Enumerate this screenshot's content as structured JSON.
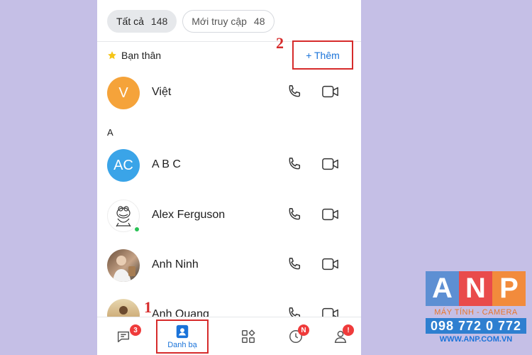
{
  "filters": {
    "all_label": "Tất cả",
    "all_count": "148",
    "recent_label": "Mới truy cập",
    "recent_count": "48"
  },
  "favorites": {
    "label": "Bạn thân",
    "add_label": "+ Thêm"
  },
  "annotations": {
    "step1": "1",
    "step2": "2"
  },
  "contacts": [
    {
      "name": "Việt",
      "initials": "V",
      "avatar_color": "#f5a33a"
    },
    {
      "name": "A B C",
      "initials": "AC",
      "avatar_color": "#3aa4e8"
    },
    {
      "name": "Alex Ferguson",
      "initials": "",
      "avatar_color": "#ffffff",
      "online": true
    },
    {
      "name": "Anh Ninh",
      "initials": "",
      "avatar_color": "#8a6a52"
    },
    {
      "name": "Anh Quang",
      "initials": "",
      "avatar_color": "#c9a66b"
    }
  ],
  "section_letter": "A",
  "bottom_nav": {
    "messages_badge": "3",
    "contacts_label": "Danh bạ",
    "timeline_badge": "N",
    "profile_badge": "!"
  },
  "logo": {
    "letters": [
      "A",
      "N",
      "P"
    ],
    "letter_colors": [
      "#5d8fd3",
      "#e94b4b",
      "#f28b3c"
    ],
    "subtitle": "MÁY TÍNH - CAMERA",
    "phone": "098 772 0 772",
    "website": "WWW.ANP.COM.VN"
  },
  "colors": {
    "accent": "#1a73d9",
    "annotation": "#d62b2b",
    "badge": "#ef3b3b",
    "background": "#c5bfe6"
  }
}
